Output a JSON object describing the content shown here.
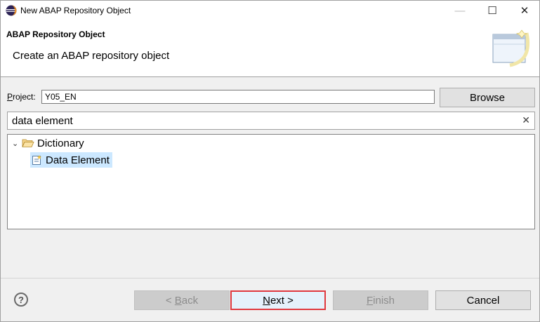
{
  "window": {
    "title": "New ABAP Repository Object",
    "controls": {
      "minimize": "—",
      "maximize": "☐",
      "close": "✕"
    }
  },
  "banner": {
    "title": "ABAP Repository Object",
    "message": "Create an ABAP repository object"
  },
  "project": {
    "label_mnemonic": "P",
    "label_rest": "roject:",
    "value": "Y05_EN"
  },
  "browse_label": "Browse",
  "filter": {
    "value": "data element",
    "clear_glyph": "✕"
  },
  "tree": {
    "items": [
      {
        "label": "Dictionary",
        "icon": "folder-open-icon",
        "expanded": true
      },
      {
        "label": "Data Element",
        "icon": "data-element-icon",
        "selected": true
      }
    ]
  },
  "buttons": {
    "back": {
      "prefix": "< ",
      "mnemonic": "B",
      "rest": "ack"
    },
    "next": {
      "mnemonic": "N",
      "rest": "ext >"
    },
    "finish": {
      "mnemonic": "F",
      "rest": "inish"
    },
    "cancel": "Cancel"
  },
  "help_glyph": "?",
  "colors": {
    "selection": "#cce8ff",
    "highlight_border": "#e0383e"
  }
}
